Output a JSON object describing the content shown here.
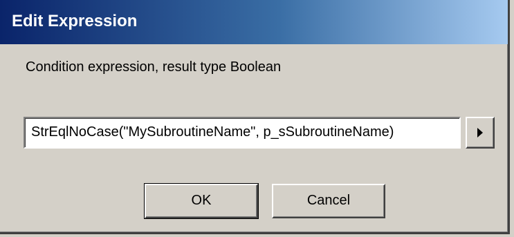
{
  "window": {
    "title": "Edit Expression"
  },
  "dialog": {
    "message": "Condition expression, result type Boolean",
    "expression_value": "StrEqlNoCase(\"MySubroutineName\", p_sSubroutineName)",
    "menu_button_icon": "right-arrow-icon",
    "ok_label": "OK",
    "cancel_label": "Cancel"
  },
  "colors": {
    "titlebar_start": "#0a246a",
    "titlebar_end": "#a6caf0",
    "face": "#d4d0c8"
  }
}
